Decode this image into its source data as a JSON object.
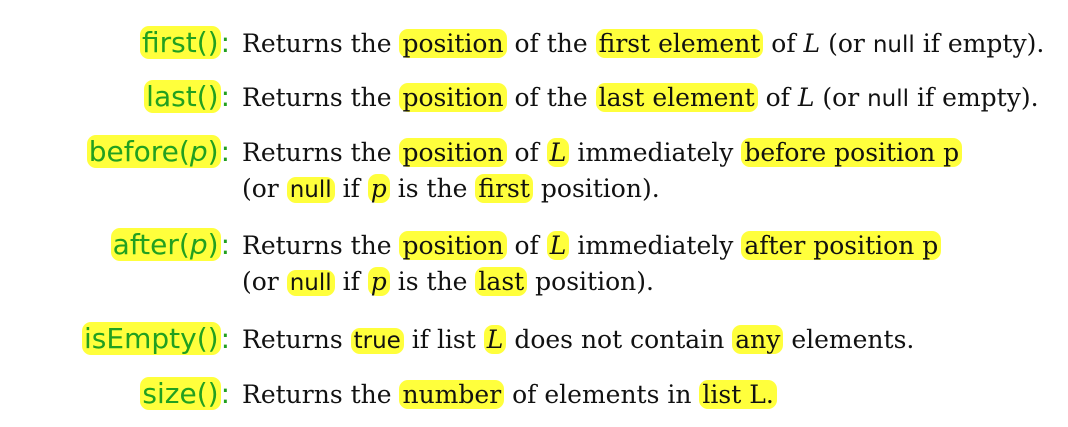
{
  "methods": [
    {
      "id": "first",
      "sig": {
        "name": "first",
        "paren_open": "(",
        "param": "",
        "paren_close": ")",
        "colon": ":"
      },
      "desc": {
        "t1": "Returns the ",
        "h1": "position",
        "t2": " of the ",
        "h2": "first element",
        "t3": " of ",
        "v1": "L",
        "t4": " (or ",
        "s1": "null",
        "t5": " if empty)."
      }
    },
    {
      "id": "last",
      "sig": {
        "name": "last",
        "paren_open": "(",
        "param": "",
        "paren_close": ")",
        "colon": ":"
      },
      "desc": {
        "t1": "Returns the ",
        "h1": "position",
        "t2": " of the ",
        "h2": "last element",
        "t3": " of ",
        "v1": "L",
        "t4": " (or ",
        "s1": "null",
        "t5": " if empty)."
      }
    },
    {
      "id": "before",
      "sig": {
        "name": "before",
        "paren_open": "(",
        "param": "p",
        "paren_close": ")",
        "colon": ":"
      },
      "desc": {
        "t1": "Returns the ",
        "h1": "position",
        "t2": " of ",
        "h2": "L",
        "t3": " immediately ",
        "h3": "before position p",
        "l2_t1": "(or ",
        "l2_h1": "null",
        "l2_t2": " if ",
        "l2_h2": "p",
        "l2_t3": " is the ",
        "l2_h3": "first",
        "l2_t4": " position)."
      }
    },
    {
      "id": "after",
      "sig": {
        "name": "after",
        "paren_open": "(",
        "param": "p",
        "paren_close": ")",
        "colon": ":"
      },
      "desc": {
        "t1": "Returns the ",
        "h1": "position",
        "t2": " of ",
        "h2": "L",
        "t3": " immediately ",
        "h3": "after position p",
        "l2_t1": "(or ",
        "l2_h1": "null",
        "l2_t2": " if ",
        "l2_h2": "p",
        "l2_t3": " is the ",
        "l2_h3": "last",
        "l2_t4": " position)."
      }
    },
    {
      "id": "isEmpty",
      "sig": {
        "name": "isEmpty",
        "paren_open": "(",
        "param": "",
        "paren_close": ")",
        "colon": ":"
      },
      "desc": {
        "t1": "Returns ",
        "h1": "true",
        "t2": " if list ",
        "h2": "L",
        "t3": " does not contain ",
        "h3": "any",
        "t4": " elements."
      }
    },
    {
      "id": "size",
      "sig": {
        "name": "size",
        "paren_open": "(",
        "param": "",
        "paren_close": ")",
        "colon": ":"
      },
      "desc": {
        "t1": "Returns the ",
        "h1": "number",
        "t2": " of elements in ",
        "h2": "list L."
      }
    }
  ]
}
